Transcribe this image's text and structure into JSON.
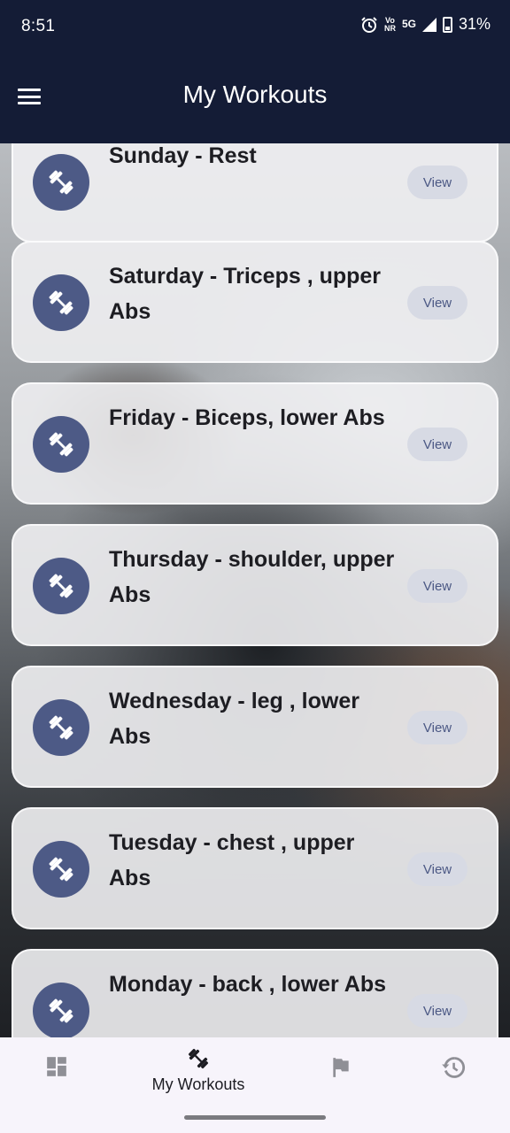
{
  "status_bar": {
    "time": "8:51",
    "volte_top": "Vo",
    "volte_bottom": "NR",
    "network": "5G",
    "battery": "31%"
  },
  "app_bar": {
    "title": "My Workouts",
    "menu_icon": "hamburger-menu-icon"
  },
  "workouts": [
    {
      "title": "Sunday - Rest",
      "button": "View",
      "icon": "dumbbell-icon"
    },
    {
      "title": "Saturday - Triceps , upper Abs",
      "button": "View",
      "icon": "dumbbell-icon"
    },
    {
      "title": "Friday - Biceps, lower Abs",
      "button": "View",
      "icon": "dumbbell-icon"
    },
    {
      "title": "Thursday - shoulder, upper Abs",
      "button": "View",
      "icon": "dumbbell-icon"
    },
    {
      "title": "Wednesday - leg , lower Abs",
      "button": "View",
      "icon": "dumbbell-icon"
    },
    {
      "title": "Tuesday - chest , upper Abs",
      "button": "View",
      "icon": "dumbbell-icon"
    },
    {
      "title": "Monday - back , lower Abs",
      "button": "View",
      "icon": "dumbbell-icon"
    }
  ],
  "bottom_nav": {
    "items": [
      {
        "icon": "dashboard-icon",
        "label": ""
      },
      {
        "icon": "dumbbell-icon",
        "label": "My Workouts"
      },
      {
        "icon": "flag-icon",
        "label": ""
      },
      {
        "icon": "history-icon",
        "label": ""
      }
    ]
  },
  "colors": {
    "app_bar": "#141c36",
    "icon_circle": "#4d5a86",
    "view_button_text": "#4b5884"
  }
}
